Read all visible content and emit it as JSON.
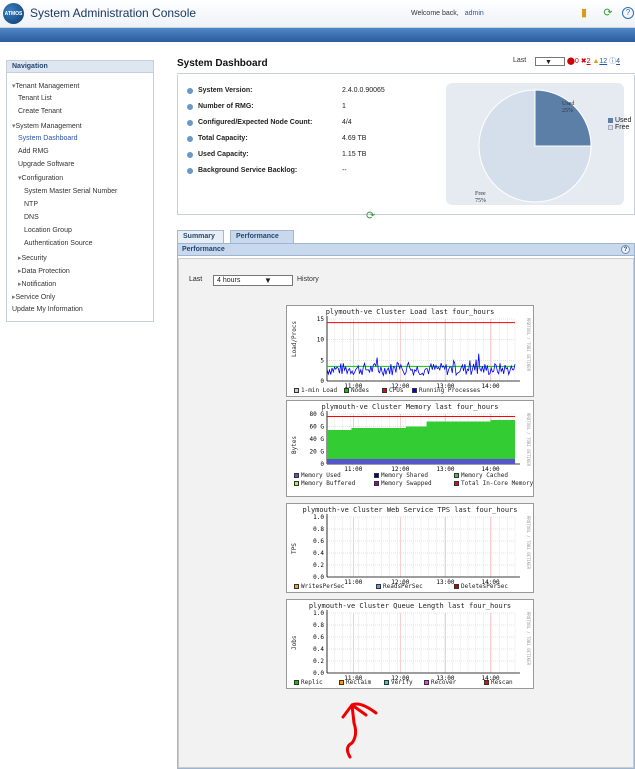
{
  "header": {
    "logo_text": "ATMOS",
    "app_title": "System Administration Console",
    "welcome": "Welcome back,",
    "user": "admin"
  },
  "nav": {
    "title": "Navigation",
    "items": [
      {
        "label": "Tenant Management",
        "level": 0,
        "expander": "▾"
      },
      {
        "label": "Tenant List",
        "level": 1
      },
      {
        "label": "Create Tenant",
        "level": 1
      },
      {
        "label": "System Management",
        "level": 0,
        "expander": "▾"
      },
      {
        "label": "System Dashboard",
        "level": 1,
        "active": true
      },
      {
        "label": "Add RMG",
        "level": 1
      },
      {
        "label": "Upgrade Software",
        "level": 1
      },
      {
        "label": "Configuration",
        "level": 1,
        "expander": "▾"
      },
      {
        "label": "System Master Serial Number",
        "level": 2
      },
      {
        "label": "NTP",
        "level": 2
      },
      {
        "label": "DNS",
        "level": 2
      },
      {
        "label": "Location Group",
        "level": 2
      },
      {
        "label": "Authentication Source",
        "level": 2
      },
      {
        "label": "Security",
        "level": 1,
        "expander": "▸"
      },
      {
        "label": "Data Protection",
        "level": 1,
        "expander": "▸"
      },
      {
        "label": "Notification",
        "level": 1,
        "expander": "▸"
      },
      {
        "label": "Service Only",
        "level": 0,
        "expander": "▸"
      },
      {
        "label": "Update My Information",
        "level": 0
      }
    ]
  },
  "dashboard": {
    "title": "System Dashboard",
    "last_label": "Last",
    "alerts": {
      "critical": "0",
      "error": "2",
      "warning": "12",
      "info": "4"
    },
    "info": [
      {
        "label": "System Version:",
        "value": "2.4.0.0.90065"
      },
      {
        "label": "Number of RMG:",
        "value": "1"
      },
      {
        "label": "Configured/Expected Node Count:",
        "value": "4/4"
      },
      {
        "label": "Total Capacity:",
        "value": "4.69 TB"
      },
      {
        "label": "Used Capacity:",
        "value": "1.15 TB"
      },
      {
        "label": "Background Service Backlog:",
        "value": "--"
      }
    ],
    "pie": {
      "used_label": "Used",
      "used_pct": "25%",
      "free_label": "Free",
      "free_pct": "75%",
      "used_color": "#5b7fa6",
      "free_color": "#d5dfeb",
      "used_fraction": 0.25
    }
  },
  "tabs": [
    "Summary",
    "Performance"
  ],
  "performance": {
    "title": "Performance",
    "last_label": "Last",
    "range_value": "4 hours",
    "history_label": "History",
    "graphs": [
      {
        "title": "plymouth-ve Cluster Load last four_hours",
        "ylabel": "Load/Procs",
        "yticks": [
          "15",
          "10",
          "5",
          "0"
        ],
        "xticks": [
          "11:00",
          "12:00",
          "13:00",
          "14:00"
        ],
        "legend": [
          {
            "label": "1-min Load",
            "color": "#cccccc"
          },
          {
            "label": "Nodes",
            "color": "#00cc00"
          },
          {
            "label": "CPUs",
            "color": "#ff0000"
          },
          {
            "label": "Running Processes",
            "color": "#0000ff"
          }
        ]
      },
      {
        "title": "plymouth-ve Cluster Memory last four_hours",
        "ylabel": "Bytes",
        "yticks": [
          "80 G",
          "60 G",
          "40 G",
          "20 G",
          "0"
        ],
        "xticks": [
          "11:00",
          "12:00",
          "13:00",
          "14:00"
        ],
        "legend": [
          {
            "label": "Memory Used",
            "color": "#5555cc"
          },
          {
            "label": "Memory Shared",
            "color": "#0000aa"
          },
          {
            "label": "Memory Cached",
            "color": "#33cc33"
          },
          {
            "label": "Memory Buffered",
            "color": "#99ff33"
          },
          {
            "label": "Memory Swapped",
            "color": "#9900aa"
          },
          {
            "label": "Total In-Core Memory",
            "color": "#ff0000"
          }
        ]
      },
      {
        "title": "plymouth-ve Cluster Web Service TPS last four_hours",
        "ylabel": "TPS",
        "yticks": [
          "1.0",
          "0.8",
          "0.6",
          "0.4",
          "0.2",
          "0.0"
        ],
        "xticks": [
          "11:00",
          "12:00",
          "13:00",
          "14:00"
        ],
        "legend": [
          {
            "label": "WritesPerSec",
            "color": "#ff9933"
          },
          {
            "label": "ReadsPerSec",
            "color": "#6699ff"
          },
          {
            "label": "DeletesPerSec",
            "color": "#cc0000"
          }
        ]
      },
      {
        "title": "plymouth-ve Cluster Queue Length last four_hours",
        "ylabel": "Jobs",
        "yticks": [
          "1.0",
          "0.8",
          "0.6",
          "0.4",
          "0.2",
          "0.0"
        ],
        "xticks": [
          "11:00",
          "12:00",
          "13:00",
          "14:00"
        ],
        "legend": [
          {
            "label": "Replic",
            "color": "#00cc00"
          },
          {
            "label": "Reclaim",
            "color": "#ff9900"
          },
          {
            "label": "Verify",
            "color": "#33cccc"
          },
          {
            "label": "Recover",
            "color": "#ff33ff"
          },
          {
            "label": "Rescan",
            "color": "#ff0000"
          }
        ]
      }
    ],
    "side_text": "RRDTOOL / TOBI OETIKER"
  }
}
